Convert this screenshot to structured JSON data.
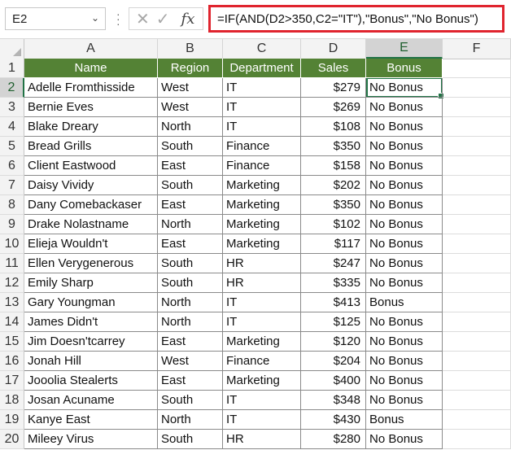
{
  "name_box": {
    "value": "E2"
  },
  "formula_bar": {
    "cancel_glyph": "✕",
    "enter_glyph": "✓",
    "fx_label": "fx",
    "formula": "=IF(AND(D2>350,C2=\"IT\"),\"Bonus\",\"No Bonus\")"
  },
  "columns": [
    "A",
    "B",
    "C",
    "D",
    "E",
    "F"
  ],
  "selected_cell": "E2",
  "headers": [
    "Name",
    "Region",
    "Department",
    "Sales",
    "Bonus"
  ],
  "row_numbers": [
    "1",
    "2",
    "3",
    "4",
    "5",
    "6",
    "7",
    "8",
    "9",
    "10",
    "11",
    "12",
    "13",
    "14",
    "15",
    "16",
    "17",
    "18",
    "19",
    "20"
  ],
  "rows": [
    [
      "Adelle Fromthisside",
      "West",
      "IT",
      "$279",
      "No Bonus"
    ],
    [
      "Bernie Eves",
      "West",
      "IT",
      "$269",
      "No Bonus"
    ],
    [
      "Blake Dreary",
      "North",
      "IT",
      "$108",
      "No Bonus"
    ],
    [
      "Bread Grills",
      "South",
      "Finance",
      "$350",
      "No Bonus"
    ],
    [
      "Client Eastwood",
      "East",
      "Finance",
      "$158",
      "No Bonus"
    ],
    [
      "Daisy Vividy",
      "South",
      "Marketing",
      "$202",
      "No Bonus"
    ],
    [
      "Dany Comebackaser",
      "East",
      "Marketing",
      "$350",
      "No Bonus"
    ],
    [
      "Drake Nolastname",
      "North",
      "Marketing",
      "$102",
      "No Bonus"
    ],
    [
      "Elieja Wouldn't",
      "East",
      "Marketing",
      "$117",
      "No Bonus"
    ],
    [
      "Ellen Verygenerous",
      "South",
      "HR",
      "$247",
      "No Bonus"
    ],
    [
      "Emily Sharp",
      "South",
      "HR",
      "$335",
      "No Bonus"
    ],
    [
      "Gary Youngman",
      "North",
      "IT",
      "$413",
      "Bonus"
    ],
    [
      "James Didn't",
      "North",
      "IT",
      "$125",
      "No Bonus"
    ],
    [
      "Jim Doesn'tcarrey",
      "East",
      "Marketing",
      "$120",
      "No Bonus"
    ],
    [
      "Jonah Hill",
      "West",
      "Finance",
      "$204",
      "No Bonus"
    ],
    [
      "Jooolia Stealerts",
      "East",
      "Marketing",
      "$400",
      "No Bonus"
    ],
    [
      "Josan Acuname",
      "South",
      "IT",
      "$348",
      "No Bonus"
    ],
    [
      "Kanye East",
      "North",
      "IT",
      "$430",
      "Bonus"
    ],
    [
      "Mileey Virus",
      "South",
      "HR",
      "$280",
      "No Bonus"
    ]
  ],
  "colors": {
    "header_fill": "#548235",
    "selection": "#217346",
    "formula_highlight": "#e0242e"
  }
}
